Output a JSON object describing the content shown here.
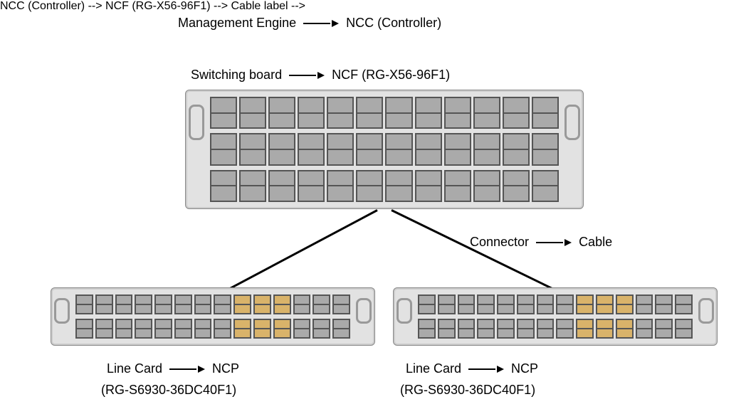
{
  "labels": {
    "mgmt_left": "Management Engine",
    "mgmt_right": "NCC (Controller)",
    "switching_left": "Switching board",
    "switching_right": "NCF (RG-X56-96F1)",
    "connector_left": "Connector",
    "connector_right": "Cable",
    "linecard_left": "Line Card",
    "linecard_right": "NCP",
    "linecard_model": "(RG-S6930-36DC40F1)"
  },
  "devices": {
    "ncf_model": "RG-X56-96F1",
    "ncp_model": "RG-S6930-36DC40F1"
  }
}
